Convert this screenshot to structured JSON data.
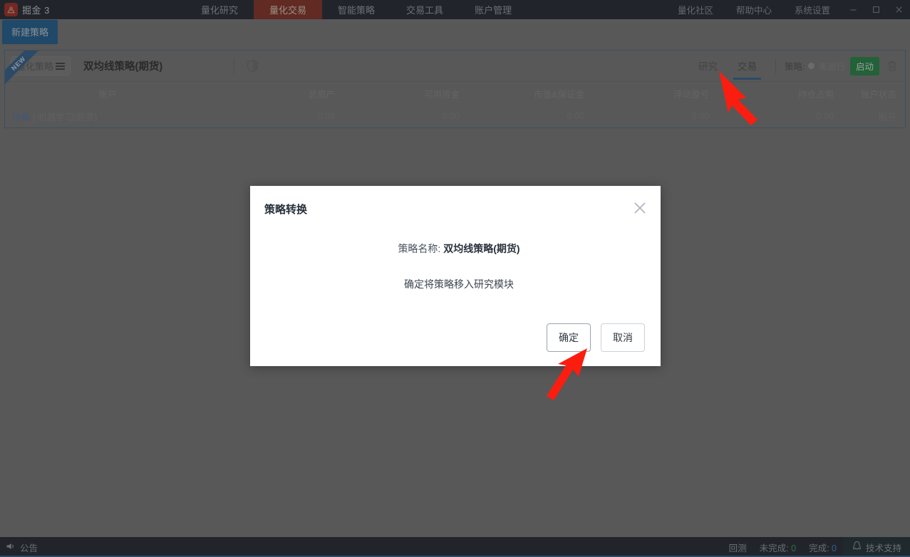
{
  "titlebar": {
    "brand": "掘金 3",
    "logo_icon": "gold-mine-logo-icon",
    "nav_center": [
      {
        "label": "量化研究",
        "active": false
      },
      {
        "label": "量化交易",
        "active": true
      },
      {
        "label": "智能策略",
        "active": false
      },
      {
        "label": "交易工具",
        "active": false
      },
      {
        "label": "账户管理",
        "active": false
      }
    ],
    "nav_right": [
      {
        "label": "量化社区"
      },
      {
        "label": "帮助中心"
      },
      {
        "label": "系统设置"
      }
    ],
    "window_controls": [
      "minimize-icon",
      "maximize-icon",
      "close-icon"
    ],
    "active_color": "#8a2b20",
    "bg_color": "#1d242e"
  },
  "toolbar": {
    "new_strategy_label": "新建策略"
  },
  "strategy_card": {
    "ribbon": "NEW",
    "chip_label": "量化策略",
    "title": "双均线策略(期货)",
    "shield_icon": "shield-icon",
    "tabs": [
      {
        "label": "研究",
        "active": false
      },
      {
        "label": "交易",
        "active": true
      }
    ],
    "run_label": "策略:",
    "run_state": "未运行",
    "start_label": "启动",
    "delete_icon": "trash-icon",
    "accent_color": "#2f6294",
    "start_color": "#1f8b46"
  },
  "account_table": {
    "columns": [
      "账户",
      "总资产",
      "可用资金",
      "市值&保证金",
      "浮动盈亏",
      "持仓占用",
      "账户状态"
    ],
    "rows": [
      {
        "account_tag": "仿真",
        "account_divider": "|",
        "account_name": "机器学习(股票)",
        "total_assets": "0.00",
        "available_funds": "0.00",
        "market_value_margin": "0.00",
        "floating_pnl": "0.00",
        "position_occupied": "0.00",
        "status": "断开"
      }
    ]
  },
  "modal": {
    "title": "策略转换",
    "close_icon": "close-icon",
    "name_label": "策略名称:",
    "name_value": "双均线策略(期货)",
    "confirm_text": "确定将策略移入研究模块",
    "ok_label": "确定",
    "cancel_label": "取消"
  },
  "statusbar": {
    "announce_icon": "megaphone-icon",
    "announce_label": "公告",
    "backtest_label": "回测",
    "incomplete_label": "未完成:",
    "incomplete_count": "0",
    "complete_label": "完成:",
    "complete_count": "0",
    "support_icon": "penguin-icon",
    "support_label": "技术支持",
    "incomplete_color": "#2fa05a",
    "complete_color": "#3d87d0"
  }
}
